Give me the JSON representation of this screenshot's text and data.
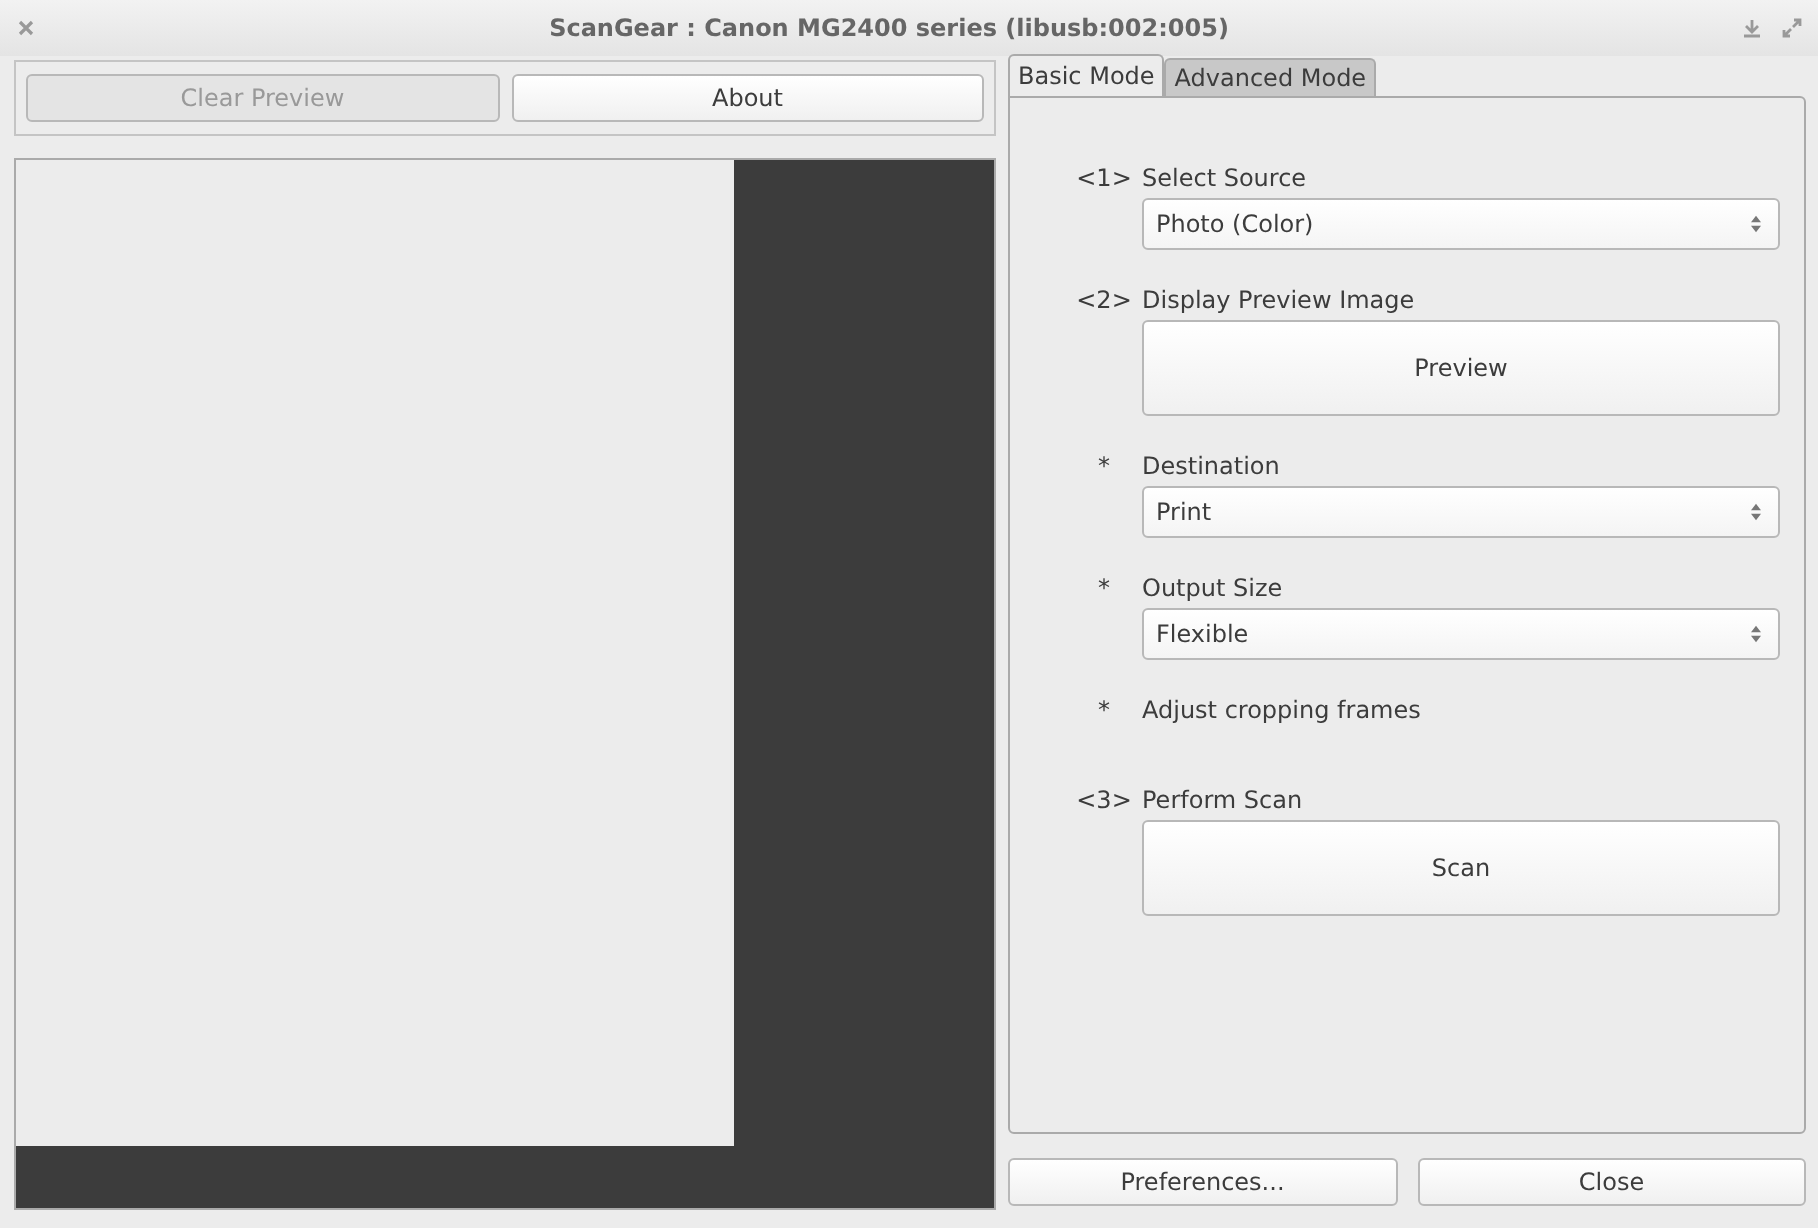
{
  "window": {
    "title": "ScanGear : Canon MG2400 series (libusb:002:005)"
  },
  "toolbar": [
    {
      "label": "Clear Preview",
      "disabled": true
    },
    {
      "label": "About",
      "disabled": false
    }
  ],
  "tabs": [
    {
      "label": "Basic Mode",
      "selected": true
    },
    {
      "label": "Advanced Mode",
      "selected": false
    }
  ],
  "steps": [
    {
      "marker": "<1>",
      "label": "Select Source",
      "kind": "dropdown",
      "value": "Photo (Color)"
    },
    {
      "marker": "<2>",
      "label": "Display Preview Image",
      "kind": "button",
      "value": "Preview"
    },
    {
      "marker": "*",
      "label": "Destination",
      "kind": "dropdown",
      "value": "Print"
    },
    {
      "marker": "*",
      "label": "Output Size",
      "kind": "dropdown",
      "value": "Flexible"
    },
    {
      "marker": "*",
      "label": "Adjust cropping frames",
      "kind": "text"
    },
    {
      "marker": "<3>",
      "label": "Perform Scan",
      "kind": "button",
      "value": "Scan"
    }
  ],
  "buttons": [
    "Preferences...",
    "Close"
  ]
}
